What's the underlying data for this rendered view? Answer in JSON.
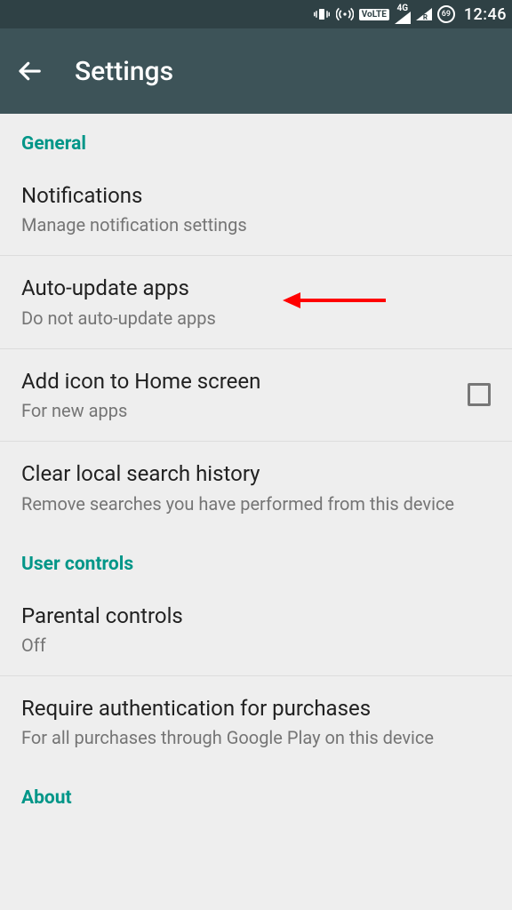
{
  "statusbar": {
    "volte": "VoLTE",
    "network": "4G",
    "roaming": "R",
    "battery": "69",
    "time": "12:46"
  },
  "appbar": {
    "title": "Settings"
  },
  "sections": {
    "general": {
      "header": "General",
      "notifications": {
        "title": "Notifications",
        "sub": "Manage notification settings"
      },
      "autoupdate": {
        "title": "Auto-update apps",
        "sub": "Do not auto-update apps"
      },
      "addicon": {
        "title": "Add icon to Home screen",
        "sub": "For new apps"
      },
      "clearhistory": {
        "title": "Clear local search history",
        "sub": "Remove searches you have performed from this device"
      }
    },
    "usercontrols": {
      "header": "User controls",
      "parental": {
        "title": "Parental controls",
        "sub": "Off"
      },
      "auth": {
        "title": "Require authentication for purchases",
        "sub": "For all purchases through Google Play on this device"
      }
    },
    "about": {
      "header": "About"
    }
  }
}
